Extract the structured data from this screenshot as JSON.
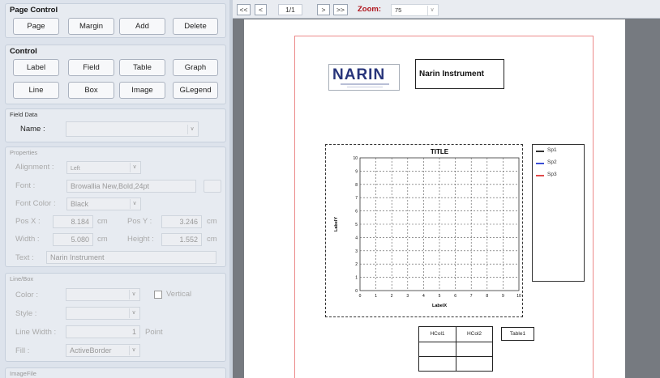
{
  "page_control": {
    "title": "Page Control",
    "buttons": [
      "Page",
      "Margin",
      "Add",
      "Delete"
    ]
  },
  "control": {
    "title": "Control",
    "row1": [
      "Label",
      "Field",
      "Table",
      "Graph"
    ],
    "row2": [
      "Line",
      "Box",
      "Image",
      "GLegend"
    ]
  },
  "field_data": {
    "title": "Field Data",
    "name_label": "Name :",
    "name_value": ""
  },
  "properties": {
    "title": "Properties",
    "alignment_label": "Alignment :",
    "alignment_value": "Left",
    "font_label": "Font :",
    "font_value": "Browallia New,Bold,24pt",
    "font_color_label": "Font Color :",
    "font_color_value": "Black",
    "pos_x_label": "Pos X :",
    "pos_x_value": "8.184",
    "pos_x_unit": "cm",
    "pos_y_label": "Pos Y :",
    "pos_y_value": "3.246",
    "pos_y_unit": "cm",
    "width_label": "Width :",
    "width_value": "5.080",
    "width_unit": "cm",
    "height_label": "Height :",
    "height_value": "1.552",
    "height_unit": "cm",
    "text_label": "Text :",
    "text_value": "Narin Instrument"
  },
  "line_box": {
    "title": "Line/Box",
    "color_label": "Color :",
    "color_value": "",
    "vertical_label": "Vertical",
    "style_label": "Style :",
    "style_value": "",
    "line_width_label": "Line Width :",
    "line_width_value": "1",
    "line_width_unit": "Point",
    "fill_label": "Fill :",
    "fill_value": "ActiveBorder"
  },
  "image_file": {
    "title": "ImageFile"
  },
  "toolbar": {
    "first": "<<",
    "prev": "<",
    "page": "1/1",
    "next": ">",
    "last": ">>",
    "zoom_label": "Zoom:",
    "zoom_value": "75"
  },
  "report": {
    "logo_text": "NARIN",
    "label_text": "Narin Instrument",
    "graph": {
      "title": "TITLE",
      "xlabel": "LabelX",
      "ylabel": "LabelY",
      "x_ticks": [
        "0",
        "1",
        "2",
        "3",
        "4",
        "5",
        "6",
        "7",
        "8",
        "9",
        "10"
      ],
      "y_ticks": [
        "0",
        "1",
        "2",
        "3",
        "4",
        "5",
        "6",
        "7",
        "8",
        "9",
        "10"
      ]
    },
    "legend": [
      {
        "name": "Sp1",
        "color": "#333333"
      },
      {
        "name": "Sp2",
        "color": "#3b4fd6"
      },
      {
        "name": "Sp3",
        "color": "#e04b4b"
      }
    ],
    "table": {
      "headers": [
        "HCol1",
        "HCol2"
      ],
      "name": "Table1"
    }
  },
  "colors": {
    "accent_zoom": "#b0141c",
    "margin": "#ec8a8a"
  }
}
